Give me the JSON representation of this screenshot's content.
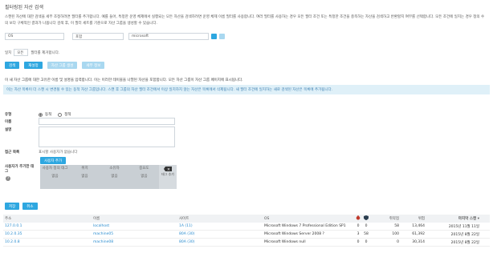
{
  "page": {
    "title": "필터링된 자산 검색",
    "description": "스캔된 자산에 대한 검색을 세부 조정하려면 필터를 추가합니다. 예를 들어, 특정한 운영 체제에서 실행되는 모든 자산을 검색하려면 운영 체제 이름 필터를 사용합니다. 여러 필터를 사용하는 경우 모든 필터 조건 또는 특정한 조건을 충족하는 자산을 검색하고 반환할지 여부를 선택합니다. 모든 조건에 일치는 경우 정의 수의 보다 구체적인 결과가 나옵니다 검색 후, 이 필터 세트를 기준으로 자산 그룹을 생성할 수 있습니다."
  },
  "filter": {
    "field": "OS",
    "operator": "포함",
    "value": "microsoft",
    "add_color": "#2ea7e0",
    "remove_color": "#a9d8f0"
  },
  "match": {
    "prefix": "일치",
    "select": "모든",
    "suffix": "필터를 제거합니다."
  },
  "buttons": {
    "search": "검색",
    "reset": "재설정",
    "export": "자산 그룹 생성",
    "load": "세부 정보"
  },
  "group_desc": "이 새 자산 그룹에 대한 고유한 이름 및 설명을 입력합니다. 이는 이러한 테이블을 나열된 자산을 포함합니다. 모든 자산 그룹이 자산 그룹 페이지에 표시됩니다.",
  "info_banner": "이는 자산 목록이 더 스캔 시 변경될 수 있는 동적 자산 그룹입니다. 스캔 후 그룹의 자산 필터 조건에서 이상 일치하지 않는 자산은 목록에서 삭제됩니다. 새 필터 조건에 일치하는 새로 검색된 자산은 목록에 추가됩니다.",
  "form": {
    "type_label": "유형",
    "type_dynamic": "동적",
    "type_static": "정적",
    "name_label": "이름",
    "desc_label": "설명",
    "access_label": "접근 목록",
    "access_value": "표시할 사용자가 없습니다",
    "add_user_button": "사용자 추가",
    "tags_label": "사용자가 추가한 태그"
  },
  "attributes": {
    "columns": [
      {
        "header": "사용자 정의 태그",
        "value": "없음"
      },
      {
        "header": "위치",
        "value": "없음"
      },
      {
        "header": "소유자",
        "value": "없음"
      },
      {
        "header": "중요도",
        "value": "없음"
      }
    ],
    "add_tag": "태그 추가"
  },
  "actions": {
    "save": "저장",
    "cancel": "취소"
  },
  "table": {
    "headers": [
      "주소",
      "이름",
      "사이트",
      "OS",
      "",
      "",
      "취약점",
      "위험",
      "마지막 스캔"
    ],
    "rows": [
      [
        "127.0.0.1",
        "localhost",
        "1A (11)",
        "Microsoft Windows 7 Professional Edition SP1",
        "0",
        "0",
        "58",
        "13,464",
        "2015년 11월 11일"
      ],
      [
        "10.2.0.35",
        "machine05",
        "80A (30)",
        "Microsoft Windows Server 2008 ?",
        "3",
        "58",
        "100",
        "61,392",
        "2015년 8월 22일"
      ],
      [
        "10.2.0.8",
        "machine08",
        "80A (30)",
        "Microsoft Windows null",
        "0",
        "0",
        "0",
        "30,314",
        "2015년 8월 22일"
      ]
    ]
  }
}
